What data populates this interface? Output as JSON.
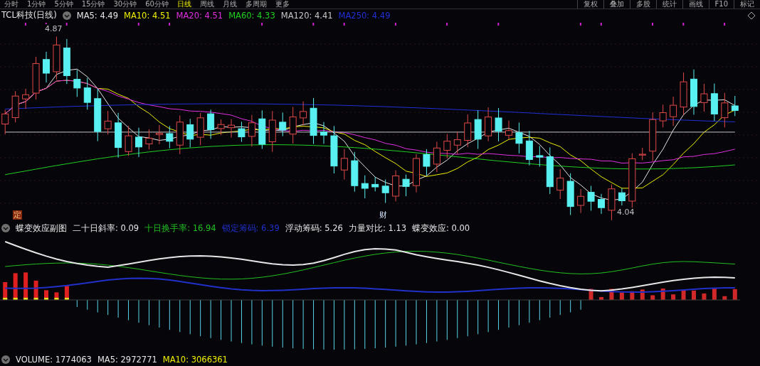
{
  "toolbar": {
    "periods": [
      {
        "label": "分时",
        "selected": false
      },
      {
        "label": "1分钟",
        "selected": false
      },
      {
        "label": "5分钟",
        "selected": false
      },
      {
        "label": "15分钟",
        "selected": false
      },
      {
        "label": "30分钟",
        "selected": false
      },
      {
        "label": "60分钟",
        "selected": false
      },
      {
        "label": "日线",
        "selected": true
      },
      {
        "label": "周线",
        "selected": false
      },
      {
        "label": "月线",
        "selected": false
      },
      {
        "label": "多周期",
        "selected": false
      },
      {
        "label": "更多",
        "selected": false
      }
    ],
    "tools": [
      "复权",
      "叠加",
      "多股",
      "统计",
      "画线",
      "F10",
      "标记"
    ]
  },
  "main_chart": {
    "title": "TCL科技(日线)",
    "indicators": [
      {
        "label": "MA5: 4.49",
        "color": "#e6e6e6"
      },
      {
        "label": "MA10: 4.51",
        "color": "#f0f000"
      },
      {
        "label": "MA20: 4.51",
        "color": "#e030e0"
      },
      {
        "label": "MA60: 4.33",
        "color": "#20d020"
      },
      {
        "label": "MA120: 4.41",
        "color": "#c8c8c8"
      },
      {
        "label": "MA250: 4.49",
        "color": "#2030d8"
      }
    ],
    "high_label": "4.87",
    "low_label": "4.04",
    "markers": [
      {
        "text": "定",
        "kind": "badge"
      },
      {
        "text": "财",
        "kind": "plain"
      }
    ]
  },
  "sub_chart": {
    "title": "蝶变效应副图",
    "indicators": [
      {
        "label": "二十日斜率: 0.09",
        "color": "#e6e6e6"
      },
      {
        "label": "十日换手率: 16.94",
        "color": "#20c020"
      },
      {
        "label": "锁定筹码: 6.39",
        "color": "#2030c8"
      },
      {
        "label": "浮动筹码: 5.26",
        "color": "#e6e6e6"
      },
      {
        "label": "力量对比: 1.13",
        "color": "#e6e6e6"
      },
      {
        "label": "蝶变效应: 0.00",
        "color": "#e6e6e6"
      }
    ]
  },
  "volume": {
    "indicators": [
      {
        "label": "VOLUME: 1774063",
        "color": "#e6e6e6"
      },
      {
        "label": "MA5: 2972771",
        "color": "#e6e6e6"
      },
      {
        "label": "MA10: 3066361",
        "color": "#f0f000"
      }
    ]
  }
}
